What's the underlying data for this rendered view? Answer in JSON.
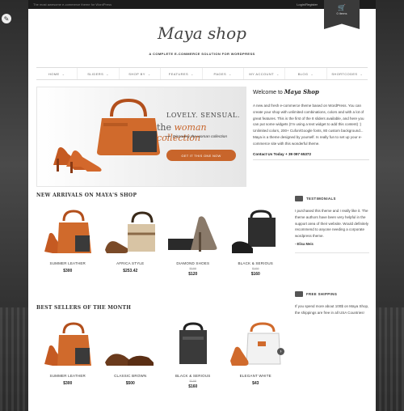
{
  "topbar": {
    "left_text": "The most awesome e-commerce theme for WordPress",
    "right_text": "Login/Register"
  },
  "cart": {
    "label": "0 items",
    "icon": "cart-icon"
  },
  "brand": {
    "logo": "Maya shop",
    "tagline": "A COMPLETE E-COMMERCE SOLUTION FOR WORDPRESS"
  },
  "nav": [
    {
      "label": "HOME"
    },
    {
      "label": "SLIDERS"
    },
    {
      "label": "SHOP BY"
    },
    {
      "label": "FEATURES"
    },
    {
      "label": "PAGES"
    },
    {
      "label": "MY ACCOUNT"
    },
    {
      "label": "BLOG"
    },
    {
      "label": "SHORTCODES"
    }
  ],
  "slider": {
    "line1": "LOVELY. SENSUAL.",
    "line2_prefix": "the",
    "line2_accent": "woman collection",
    "line3": "Discovery the woman collection",
    "cta": "GET IT THIS ONE NOW"
  },
  "welcome": {
    "title_prefix": "Welcome to",
    "title_brand": "Maya Shop",
    "text": "A new and fresh e-commerce theme based on WordPress. You can create your shop with unlimited combinations, colors and with a lot of great features. This is the first of the 8 sliders available, and here you can put some widgets (I'm using a text widget to add this content) :) Unlimited colors, 200+ Cufon/Google fonts, 80 custom background... Maya is a theme designed by yourself. Is really fun to set up your e-commerce site with this wonderful theme.",
    "contact": "Contact Us Today + 39 097 65372"
  },
  "new_arrivals": {
    "title": "NEW ARRIVALS ON MAYA'S SHOP",
    "items": [
      {
        "name": "SUMMER LEATHER",
        "price": "$300",
        "old": ""
      },
      {
        "name": "AFRICA STYLE",
        "price": "$253.42",
        "old": ""
      },
      {
        "name": "DIAMOND SHOES",
        "price": "$120",
        "old": "$199"
      },
      {
        "name": "BLACK & SERIOUS",
        "price": "$160",
        "old": "$199"
      }
    ]
  },
  "best_sellers": {
    "title": "BEST SELLERS OF THE MONTH",
    "items": [
      {
        "name": "SUMMER LEATHER",
        "price": "$300",
        "old": ""
      },
      {
        "name": "CLASSIC BROWN",
        "price": "$500",
        "old": ""
      },
      {
        "name": "BLACK & SERIOUS",
        "price": "$160",
        "old": "$199"
      },
      {
        "name": "ELEGANT WHITE",
        "price": "$43",
        "old": ""
      }
    ]
  },
  "testimonials": {
    "title": "TESTIMONIALS",
    "text": "I purchased this theme and I really like it. The theme authors have been very helpful in the support area of their website. Would definitely recommend to anyone needing a corporate wordpress theme.",
    "author": "- Elisa Meis"
  },
  "free_shipping": {
    "title": "FREE SHIPPING",
    "text": "If you spend more about 100$ on Maya Shop, the shippings are free in all USA Countries!"
  },
  "colors": {
    "accent": "#c8652b",
    "dark": "#3a3a3a"
  }
}
